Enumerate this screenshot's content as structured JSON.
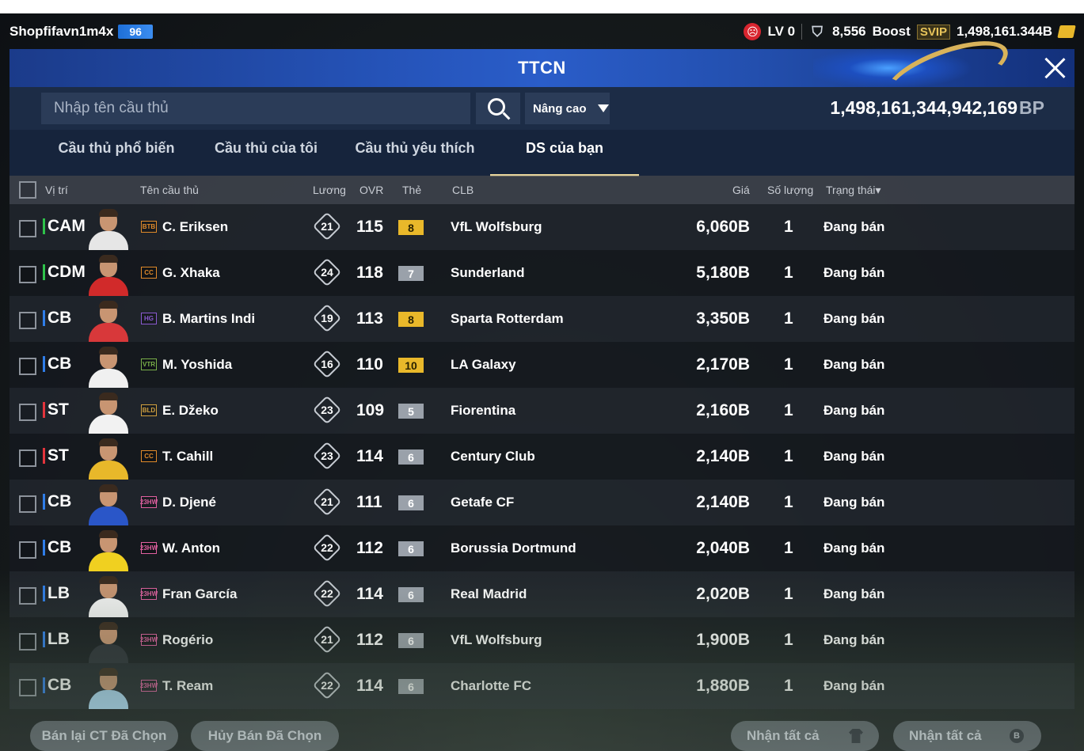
{
  "topbar": {
    "username": "Shopfifavn1m4x",
    "user_level": "96",
    "lv": "LV 0",
    "trophies": "8,556",
    "boost_label": "Boost",
    "svip": "SVIP",
    "bp_short": "1,498,161.344B"
  },
  "panel": {
    "title": "TTCN",
    "search_placeholder": "Nhập tên cầu thủ",
    "advanced_label": "Nâng cao",
    "bp_total": "1,498,161,344,942,169",
    "bp_unit": "BP"
  },
  "tabs": [
    {
      "label": "Cầu thủ phổ biến"
    },
    {
      "label": "Cầu thủ của tôi"
    },
    {
      "label": "Cầu thủ yêu thích"
    },
    {
      "label": "DS của bạn"
    }
  ],
  "columns": {
    "position": "Vị trí",
    "name": "Tên cầu thủ",
    "wage": "Lương",
    "ovr": "OVR",
    "grade": "Thẻ",
    "club": "CLB",
    "price": "Giá",
    "quantity": "Số lượng",
    "status": "Trạng thái▾"
  },
  "colors": {
    "mid": "#2ec24a",
    "def": "#2f7de8",
    "att": "#e3343c",
    "grade_gold": "#e9b82a",
    "grade_silver": "#9aa1aa"
  },
  "rows": [
    {
      "pos": "CAM",
      "line": "mid",
      "season": "BTB",
      "season_color": "#e08a2a",
      "name": "C. Eriksen",
      "wage": "21",
      "ovr": "115",
      "grade": "8",
      "grade_tier": "gold",
      "club": "VfL Wolfsburg",
      "price": "6,060B",
      "qty": "1",
      "status": "Đang bán",
      "kit": "#e6e6e6"
    },
    {
      "pos": "CDM",
      "line": "mid",
      "season": "CC",
      "season_color": "#e08a2a",
      "name": "G. Xhaka",
      "wage": "24",
      "ovr": "118",
      "grade": "7",
      "grade_tier": "silver",
      "club": "Sunderland",
      "price": "5,180B",
      "qty": "1",
      "status": "Đang bán",
      "kit": "#d12a2a"
    },
    {
      "pos": "CB",
      "line": "def",
      "season": "HG",
      "season_color": "#8a5ad0",
      "name": "B. Martins Indi",
      "wage": "19",
      "ovr": "113",
      "grade": "8",
      "grade_tier": "gold",
      "club": "Sparta Rotterdam",
      "price": "3,350B",
      "qty": "1",
      "status": "Đang bán",
      "kit": "#d8383a"
    },
    {
      "pos": "CB",
      "line": "def",
      "season": "VTR",
      "season_color": "#7ab04a",
      "name": "M. Yoshida",
      "wage": "16",
      "ovr": "110",
      "grade": "10",
      "grade_tier": "gold",
      "club": "LA Galaxy",
      "price": "2,170B",
      "qty": "1",
      "status": "Đang bán",
      "kit": "#f0f0f0"
    },
    {
      "pos": "ST",
      "line": "att",
      "season": "BLD",
      "season_color": "#d0a040",
      "name": "E. Džeko",
      "wage": "23",
      "ovr": "109",
      "grade": "5",
      "grade_tier": "silver",
      "club": "Fiorentina",
      "price": "2,160B",
      "qty": "1",
      "status": "Đang bán",
      "kit": "#f2f2f2"
    },
    {
      "pos": "ST",
      "line": "att",
      "season": "CC",
      "season_color": "#e08a2a",
      "name": "T. Cahill",
      "wage": "23",
      "ovr": "114",
      "grade": "6",
      "grade_tier": "silver",
      "club": "Century Club",
      "price": "2,140B",
      "qty": "1",
      "status": "Đang bán",
      "kit": "#e8b82a"
    },
    {
      "pos": "CB",
      "line": "def",
      "season": "23HW",
      "season_color": "#e060a0",
      "name": "D. Djené",
      "wage": "21",
      "ovr": "111",
      "grade": "6",
      "grade_tier": "silver",
      "club": "Getafe CF",
      "price": "2,140B",
      "qty": "1",
      "status": "Đang bán",
      "kit": "#2a56c8"
    },
    {
      "pos": "CB",
      "line": "def",
      "season": "23HW",
      "season_color": "#e060a0",
      "name": "W. Anton",
      "wage": "22",
      "ovr": "112",
      "grade": "6",
      "grade_tier": "silver",
      "club": "Borussia Dortmund",
      "price": "2,040B",
      "qty": "1",
      "status": "Đang bán",
      "kit": "#f0d020"
    },
    {
      "pos": "LB",
      "line": "def",
      "season": "23HW",
      "season_color": "#e060a0",
      "name": "Fran García",
      "wage": "22",
      "ovr": "114",
      "grade": "6",
      "grade_tier": "silver",
      "club": "Real Madrid",
      "price": "2,020B",
      "qty": "1",
      "status": "Đang bán",
      "kit": "#f4f4f4"
    },
    {
      "pos": "LB",
      "line": "def",
      "season": "23HW",
      "season_color": "#e060a0",
      "name": "Rogério",
      "wage": "21",
      "ovr": "112",
      "grade": "6",
      "grade_tier": "silver",
      "club": "VfL Wolfsburg",
      "price": "1,900B",
      "qty": "1",
      "status": "Đang bán",
      "kit": "#2a2e36"
    },
    {
      "pos": "CB",
      "line": "def",
      "season": "23HW",
      "season_color": "#e060a0",
      "name": "T. Ream",
      "wage": "22",
      "ovr": "114",
      "grade": "6",
      "grade_tier": "silver",
      "club": "Charlotte FC",
      "price": "1,880B",
      "qty": "1",
      "status": "Đang bán",
      "kit": "#a8d4f0"
    }
  ],
  "footer": {
    "resell": "Bán lại CT Đã Chọn",
    "cancel": "Hủy Bán Đã Chọn",
    "collect_players": "Nhận tất cả",
    "collect_bp": "Nhận tất cả"
  }
}
